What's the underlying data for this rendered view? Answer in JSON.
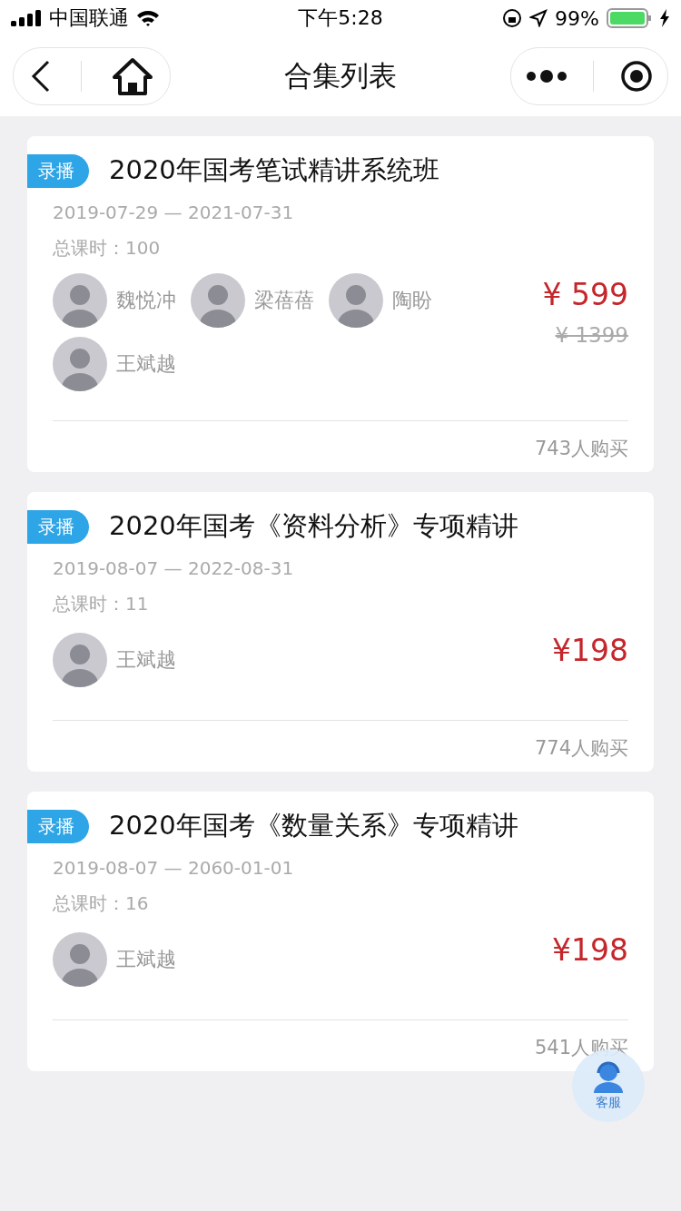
{
  "status_bar": {
    "carrier": "中国联通",
    "time": "下午5:28",
    "battery": "99%"
  },
  "nav": {
    "title": "合集列表"
  },
  "courses": [
    {
      "badge": "录播",
      "title": "2020年国考笔试精讲系统班",
      "dates": "2019-07-29 — 2021-07-31",
      "hours": "总课时：100",
      "teachers": [
        "魏悦冲",
        "梁蓓蓓",
        "陶盼",
        "王斌越"
      ],
      "price": "¥ 599",
      "original_price": "¥ 1399",
      "buyers": "743人购买"
    },
    {
      "badge": "录播",
      "title": "2020年国考《资料分析》专项精讲",
      "dates": "2019-08-07 — 2022-08-31",
      "hours": "总课时：11",
      "teachers": [
        "王斌越"
      ],
      "price": "¥198",
      "buyers": "774人购买"
    },
    {
      "badge": "录播",
      "title": "2020年国考《数量关系》专项精讲",
      "dates": "2019-08-07 — 2060-01-01",
      "hours": "总课时：16",
      "teachers": [
        "王斌越"
      ],
      "price": "¥198",
      "buyers": "541人购买"
    }
  ],
  "service_button": {
    "label": "客服"
  }
}
